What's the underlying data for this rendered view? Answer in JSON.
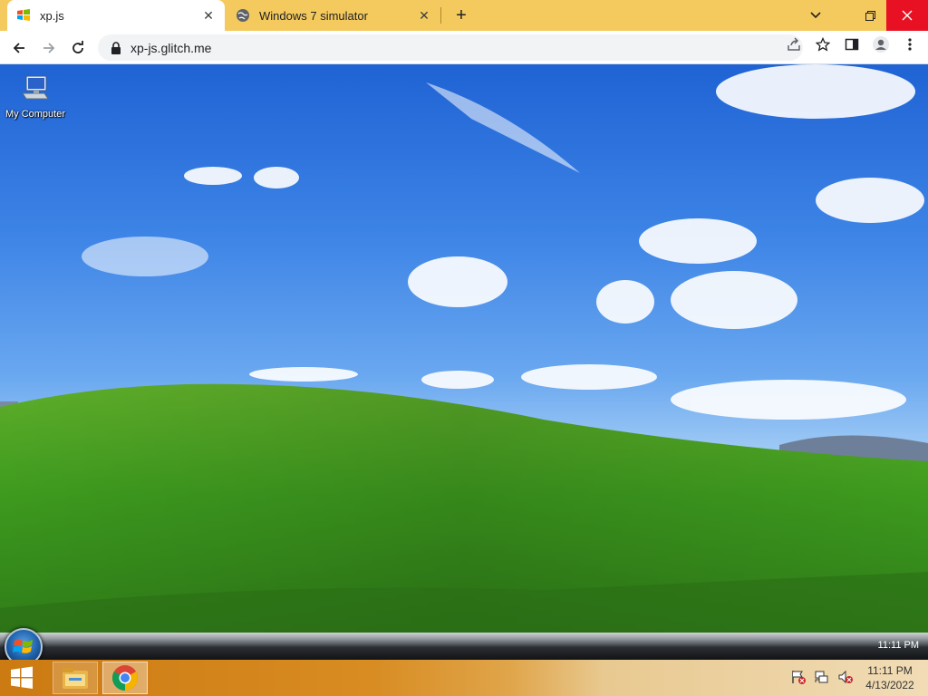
{
  "browser": {
    "tabs": [
      {
        "title": "xp.js",
        "favicon": "windows-flag-icon",
        "active": true
      },
      {
        "title": "Windows 7 simulator",
        "favicon": "globe-icon",
        "active": false
      }
    ],
    "new_tab_label": "+",
    "url": "xp-js.glitch.me"
  },
  "desktop": {
    "icons": [
      {
        "label": "My Computer",
        "icon": "my-computer-icon"
      }
    ]
  },
  "inner_taskbar": {
    "clock": "11:11 PM"
  },
  "host_taskbar": {
    "time": "11:11 PM",
    "date": "4/13/2022",
    "pinned": [
      "file-explorer-icon",
      "chrome-icon"
    ]
  },
  "colors": {
    "tab_strip": "#f4c95d",
    "close_button": "#e81123"
  }
}
